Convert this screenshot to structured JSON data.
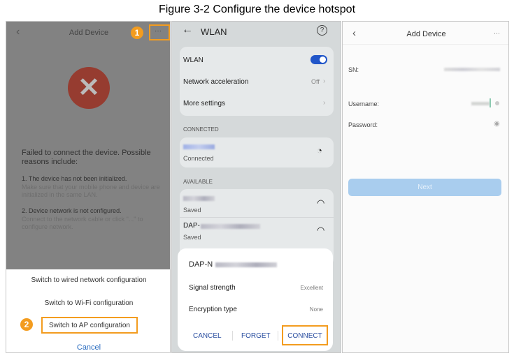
{
  "figure_title": "Figure 3-2 Configure the device hotspot",
  "panel1": {
    "header_title": "Add Device",
    "back_icon": "‹",
    "more_icon": "···",
    "badge1": "1",
    "badge2": "2",
    "error_title": "Failed to connect the device. Possible reasons include:",
    "reason1_title": "1. The device has not been initialized.",
    "reason1_detail": "Make sure that your mobile phone and device are initialized in the same LAN.",
    "reason2_title": "2. Device network is not configured.",
    "reason2_detail": "Connect to the network cable or click \"...\" to configure network.",
    "sheet": {
      "wired": "Switch to wired network configuration",
      "wifi": "Switch to Wi-Fi configuration",
      "ap": "Switch to AP configuration",
      "cancel": "Cancel"
    }
  },
  "panel2": {
    "header_title": "WLAN",
    "help_icon": "?",
    "wlan_label": "WLAN",
    "wlan_enabled": true,
    "net_accel": "Network acceleration",
    "net_accel_value": "Off",
    "more_settings": "More settings",
    "connected_header": "CONNECTED",
    "connected_status": "Connected",
    "available_header": "AVAILABLE",
    "saved1": "Saved",
    "dap_prefix": "DAP-",
    "saved2": "Saved",
    "dialog": {
      "ssid_prefix": "DAP-N",
      "signal_label": "Signal strength",
      "signal_value": "Excellent",
      "enc_label": "Encryption type",
      "enc_value": "None",
      "cancel": "CANCEL",
      "forget": "FORGET",
      "connect": "CONNECT"
    }
  },
  "panel3": {
    "header_title": "Add Device",
    "back_icon": "‹",
    "more_icon": "···",
    "sn_label": "SN:",
    "username_label": "Username:",
    "password_label": "Password:",
    "next": "Next"
  },
  "colors": {
    "accent": "#f39c1f",
    "link": "#2b5fb0",
    "next_btn": "#a9cdee"
  }
}
